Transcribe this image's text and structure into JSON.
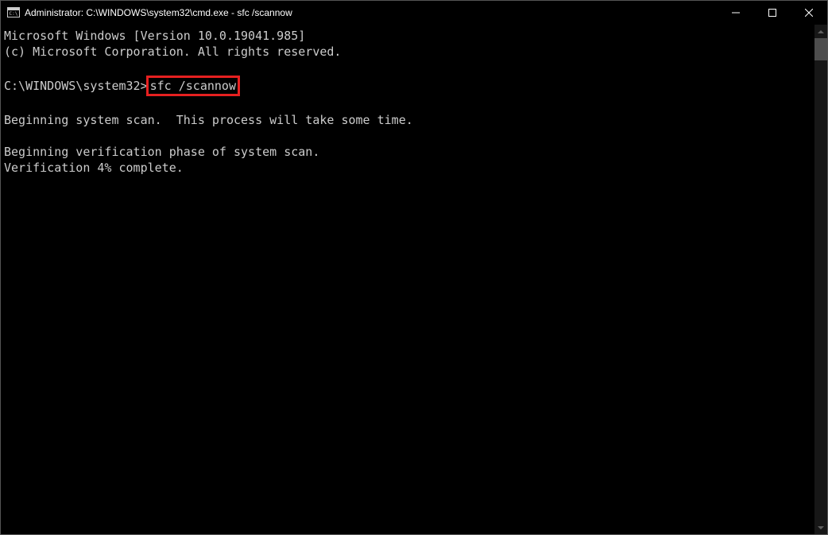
{
  "titlebar": {
    "title": "Administrator: C:\\WINDOWS\\system32\\cmd.exe - sfc  /scannow"
  },
  "terminal": {
    "line1": "Microsoft Windows [Version 10.0.19041.985]",
    "line2": "(c) Microsoft Corporation. All rights reserved.",
    "prompt": "C:\\WINDOWS\\system32>",
    "command": "sfc /scannow",
    "line4": "Beginning system scan.  This process will take some time.",
    "line5": "Beginning verification phase of system scan.",
    "line6": "Verification 4% complete."
  }
}
